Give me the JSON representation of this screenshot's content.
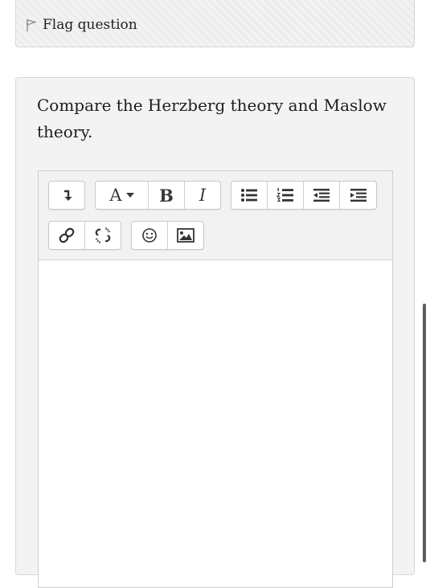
{
  "flag": {
    "label": "Flag question",
    "icon": "flag-icon"
  },
  "question": {
    "text": "Compare the Herzberg theory and Maslow theory."
  },
  "toolbar": {
    "row1": [
      {
        "name": "collapse-toolbar-button",
        "icon": "arrow-down-icon"
      },
      {
        "name": "font-style-button",
        "label": "A",
        "icon": "caret-down-icon"
      },
      {
        "name": "bold-button",
        "label": "B"
      },
      {
        "name": "italic-button",
        "label": "I"
      },
      {
        "name": "unordered-list-button",
        "icon": "bullet-list-icon"
      },
      {
        "name": "ordered-list-button",
        "icon": "numbered-list-icon"
      },
      {
        "name": "outdent-button",
        "icon": "outdent-icon"
      },
      {
        "name": "indent-button",
        "icon": "indent-icon"
      }
    ],
    "row2": [
      {
        "name": "link-button",
        "icon": "link-icon"
      },
      {
        "name": "unlink-button",
        "icon": "unlink-icon"
      },
      {
        "name": "emoji-button",
        "icon": "smiley-icon"
      },
      {
        "name": "image-button",
        "icon": "image-icon"
      }
    ]
  },
  "editor": {
    "value": ""
  },
  "colors": {
    "panel_bg": "#f3f3f3",
    "border": "#d6d6d6",
    "text": "#1d1d1d",
    "scrollbar": "#5e5e5e"
  }
}
